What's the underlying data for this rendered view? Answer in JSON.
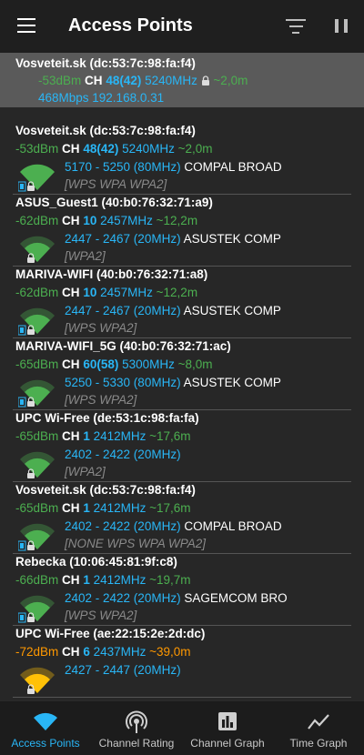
{
  "app_bar": {
    "title": "Access Points"
  },
  "connected": {
    "ssid": "Vosveteit.sk (dc:53:7c:98:fa:f4)",
    "signal": "-53dBm",
    "ch_label": "CH",
    "ch_value": "48(42)",
    "freq": "5240MHz",
    "distance": "~2,0m",
    "speed_ip": "468Mbps 192.168.0.31"
  },
  "access_points": [
    {
      "name": "Vosveteit.sk (dc:53:7c:98:fa:f4)",
      "signal": "-53dBm",
      "ch_label": "CH",
      "channel": "48(42)",
      "freq": "5240MHz",
      "distance": "~2,0m",
      "range": "5170 - 5250 (80MHz)",
      "vendor": "COMPAL BROAD",
      "capabilities": "[WPS WPA WPA2]",
      "signal_color": "#4caf50",
      "signal_level": "strong",
      "secured": true,
      "wps": true
    },
    {
      "name": "ASUS_Guest1 (40:b0:76:32:71:a9)",
      "signal": "-62dBm",
      "ch_label": "CH",
      "channel": "10",
      "freq": "2457MHz",
      "distance": "~12,2m",
      "range": "2447 - 2467 (20MHz)",
      "vendor": "ASUSTEK COMP",
      "capabilities": "[WPA2]",
      "signal_color": "#4caf50",
      "signal_level": "good",
      "secured": true,
      "wps": false
    },
    {
      "name": "MARIVA-WIFI (40:b0:76:32:71:a8)",
      "signal": "-62dBm",
      "ch_label": "CH",
      "channel": "10",
      "freq": "2457MHz",
      "distance": "~12,2m",
      "range": "2447 - 2467 (20MHz)",
      "vendor": "ASUSTEK COMP",
      "capabilities": "[WPS WPA2]",
      "signal_color": "#4caf50",
      "signal_level": "good",
      "secured": true,
      "wps": true
    },
    {
      "name": "MARIVA-WIFI_5G (40:b0:76:32:71:ac)",
      "signal": "-65dBm",
      "ch_label": "CH",
      "channel": "60(58)",
      "freq": "5300MHz",
      "distance": "~8,0m",
      "range": "5250 - 5330 (80MHz)",
      "vendor": "ASUSTEK COMP",
      "capabilities": "[WPS WPA2]",
      "signal_color": "#4caf50",
      "signal_level": "good",
      "secured": true,
      "wps": true
    },
    {
      "name": "UPC Wi-Free (de:53:1c:98:fa:fa)",
      "signal": "-65dBm",
      "ch_label": "CH",
      "channel": "1",
      "freq": "2412MHz",
      "distance": "~17,6m",
      "range": "2402 - 2422 (20MHz)",
      "vendor": "",
      "capabilities": "[WPA2]",
      "signal_color": "#4caf50",
      "signal_level": "good",
      "secured": true,
      "wps": false
    },
    {
      "name": "Vosveteit.sk (dc:53:7c:98:fa:f4)",
      "signal": "-65dBm",
      "ch_label": "CH",
      "channel": "1",
      "freq": "2412MHz",
      "distance": "~17,6m",
      "range": "2402 - 2422 (20MHz)",
      "vendor": "COMPAL BROAD",
      "capabilities": "[NONE WPS WPA WPA2]",
      "signal_color": "#4caf50",
      "signal_level": "good",
      "secured": true,
      "wps": true
    },
    {
      "name": "Rebecka (10:06:45:81:9f:c8)",
      "signal": "-66dBm",
      "ch_label": "CH",
      "channel": "1",
      "freq": "2412MHz",
      "distance": "~19,7m",
      "range": "2402 - 2422 (20MHz)",
      "vendor": "SAGEMCOM BRO",
      "capabilities": "[WPS WPA2]",
      "signal_color": "#4caf50",
      "signal_level": "good",
      "secured": true,
      "wps": true
    },
    {
      "name": "UPC Wi-Free (ae:22:15:2e:2d:dc)",
      "signal": "-72dBm",
      "ch_label": "CH",
      "channel": "6",
      "freq": "2437MHz",
      "distance": "~39,0m",
      "range": "2427 - 2447 (20MHz)",
      "vendor": "",
      "capabilities": "",
      "signal_color": "#ff9800",
      "signal_level": "fair",
      "secured": true,
      "wps": false
    }
  ],
  "bottom_nav": [
    {
      "label": "Access Points",
      "icon": "wifi-icon",
      "active": true
    },
    {
      "label": "Channel Rating",
      "icon": "signal-broadcast-icon",
      "active": false
    },
    {
      "label": "Channel Graph",
      "icon": "bar-chart-icon",
      "active": false
    },
    {
      "label": "Time Graph",
      "icon": "line-chart-icon",
      "active": false
    }
  ],
  "colors": {
    "accent": "#29b6f6",
    "good": "#4caf50",
    "fair": "#ff9800",
    "fair_fill": "#ffc107"
  }
}
